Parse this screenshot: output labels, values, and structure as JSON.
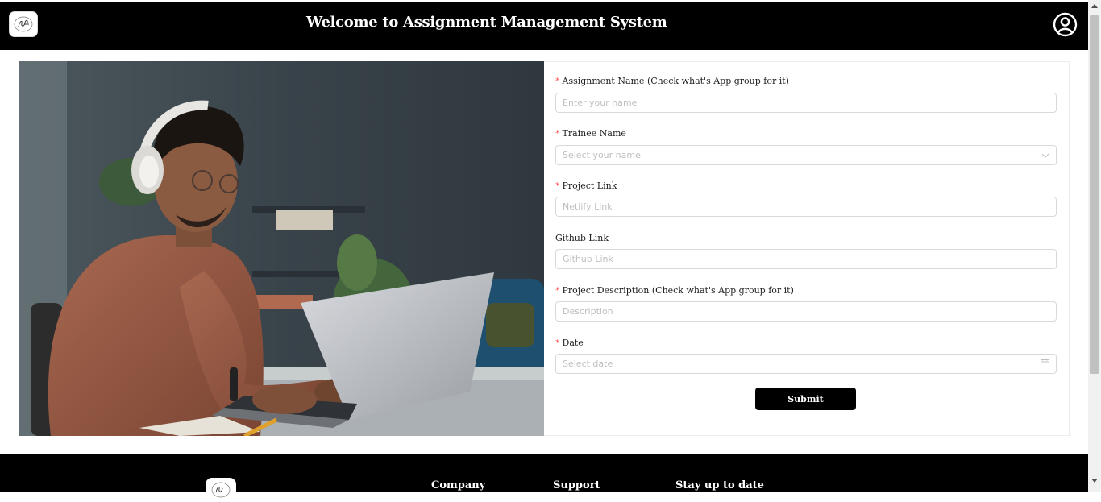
{
  "header": {
    "title": "Welcome to Assignment Management System",
    "logo_icon": "sf-monogram-logo",
    "user_icon": "user-circle-icon"
  },
  "form": {
    "fields": [
      {
        "label": "Assignment Name (Check what's App group for it)",
        "required": true,
        "placeholder": "Enter your name",
        "type": "text"
      },
      {
        "label": "Trainee Name",
        "required": true,
        "placeholder": "Select your name",
        "type": "select"
      },
      {
        "label": "Project Link",
        "required": true,
        "placeholder": "Netlify Link",
        "type": "text"
      },
      {
        "label": "Github Link",
        "required": false,
        "placeholder": "Github Link",
        "type": "text"
      },
      {
        "label": "Project Description (Check what's App group for it)",
        "required": true,
        "placeholder": "Description",
        "type": "text"
      },
      {
        "label": "Date",
        "required": true,
        "placeholder": "Select date",
        "type": "date"
      }
    ],
    "required_mark": "*",
    "submit_label": "Submit"
  },
  "footer": {
    "columns": [
      "Company",
      "Support",
      "Stay up to date"
    ]
  },
  "colors": {
    "header_bg": "#000000",
    "required": "#ff4d4f",
    "button_bg": "#000000",
    "placeholder": "#bfbfbf"
  }
}
